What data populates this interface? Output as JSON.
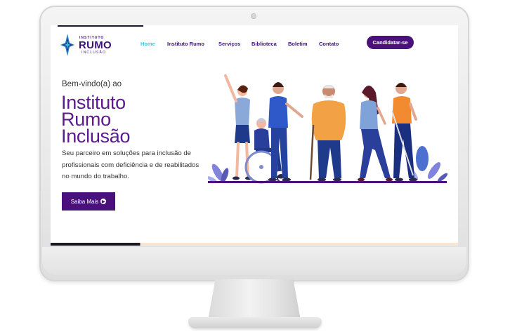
{
  "logo": {
    "line1": "INSTITUTO",
    "line2": "RUMO",
    "line3": "INCLUSÃO"
  },
  "nav": {
    "items": [
      {
        "label": "Home",
        "active": true
      },
      {
        "label": "Instituto Rumo"
      },
      {
        "label": "Serviços"
      },
      {
        "label": "Biblioteca"
      },
      {
        "label": "Boletim"
      },
      {
        "label": "Contato"
      }
    ],
    "cta_label": "Candidatar-se"
  },
  "hero": {
    "welcome": "Bem-vindo(a) ao",
    "title_lines": [
      "Instituto",
      "Rumo",
      "Inclusão"
    ],
    "description": "Seu parceiro em soluções para inclusão de profissionais com deficiência e de reabilitados no mundo do trabalho.",
    "button_label": "Saiba Mais"
  },
  "colors": {
    "brand_purple": "#4a117c",
    "title_purple": "#5c1a8e",
    "active_link": "#3cc6e0"
  }
}
